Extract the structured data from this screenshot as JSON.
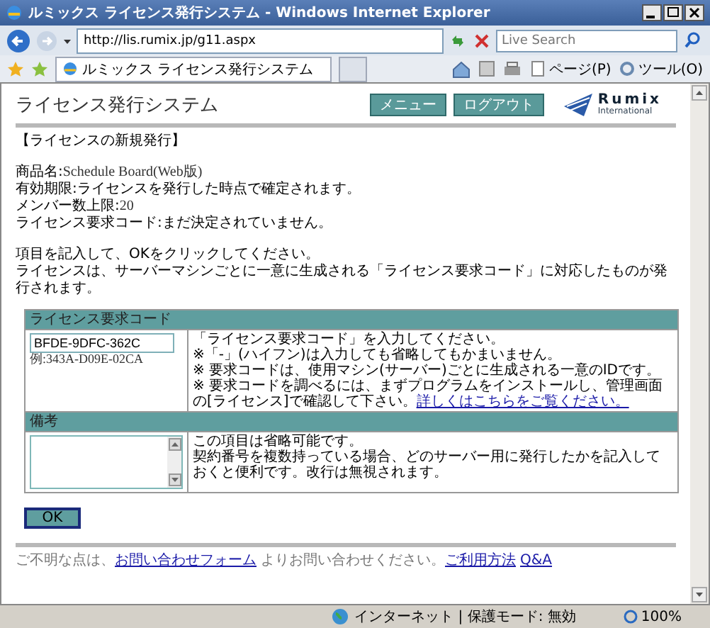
{
  "window": {
    "title": "ルミックス ライセンス発行システム - Windows Internet Explorer"
  },
  "browser": {
    "url": "http://lis.rumix.jp/g11.aspx",
    "search": {
      "placeholder": "Live Search"
    },
    "tab": {
      "label": "ルミックス ライセンス発行システム",
      "selected": true
    },
    "tools": [
      {
        "label": "ページ(P)"
      },
      {
        "label": "ツール(O)"
      }
    ]
  },
  "page": {
    "title": "ライセンス発行システム",
    "nav": [
      {
        "label": "メニュー"
      },
      {
        "label": "ログアウト"
      }
    ],
    "logo": {
      "name": "Rumix",
      "sub": "International"
    },
    "section": "【ライセンスの新規発行】",
    "info": [
      {
        "label": "商品名:",
        "value": "Schedule Board(Web版)"
      },
      {
        "label": "有効期限:",
        "value": "ライセンスを発行した時点で確定されます。"
      },
      {
        "label": "メンバー数上限:",
        "value": "20"
      },
      {
        "label": "ライセンス要求コード:",
        "value": "まだ決定されていません。"
      }
    ],
    "instructions": [
      "項目を記入して、OKをクリックしてください。",
      "ライセンスは、サーバーマシンごとに一意に生成される「ライセンス要求コード」に対応したものが発行されます。"
    ],
    "form": [
      {
        "header": "ライセンス要求コード",
        "kind": "input",
        "value": "BFDE-9DFC-362C",
        "example": "例:343A-D09E-02CA",
        "help": [
          "「ライセンス要求コード」を入力してください。",
          "※「-」(ハイフン)は入力しても省略してもかまいません。",
          "※ 要求コードは、使用マシン(サーバー)ごとに生成される一意のIDです。",
          "※ 要求コードを調べるには、まずプログラムをインストールし、管理画面の[ライセンス]で確認して下さい。"
        ],
        "link": "詳しくはこちらをご覧ください。"
      },
      {
        "header": "備考",
        "kind": "textarea",
        "help": [
          "この項目は省略可能です。",
          "契約番号を複数持っている場合、どのサーバー用に発行したかを記入しておくと便利です。改行は無視されます。"
        ]
      }
    ],
    "submit": "OK",
    "footer": [
      {
        "kind": "text",
        "text": "ご不明な点は、"
      },
      {
        "kind": "link",
        "text": "お問い合わせフォーム"
      },
      {
        "kind": "text",
        "text": "よりお問い合わせください。"
      },
      {
        "kind": "link",
        "text": "ご利用方法"
      },
      {
        "kind": "link",
        "text": "Q&A"
      }
    ]
  },
  "status_bar": {
    "zone": "インターネット | 保護モード: 無効",
    "zoom": "100%"
  }
}
